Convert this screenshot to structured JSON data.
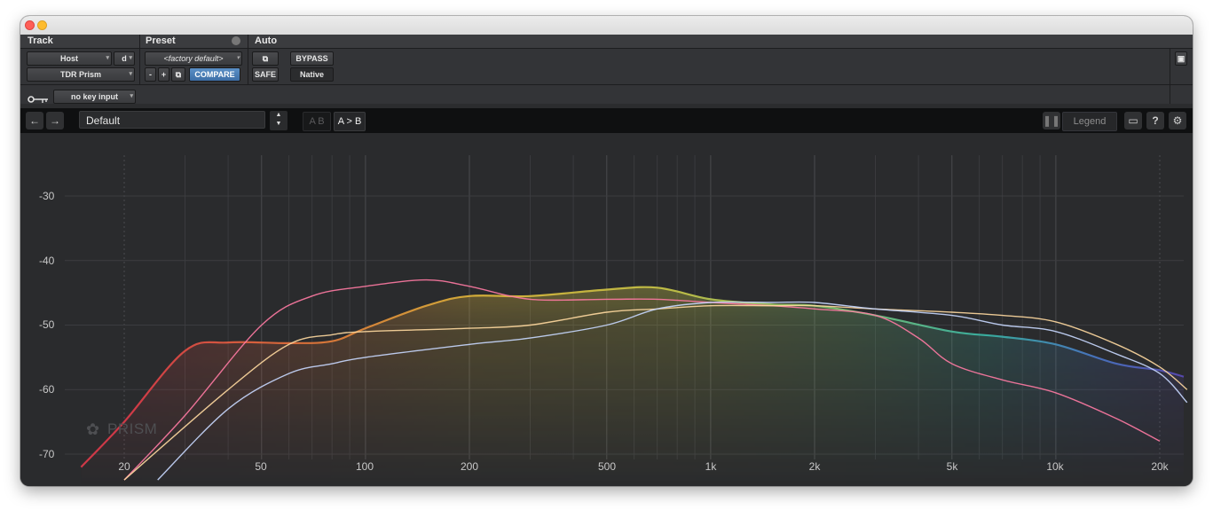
{
  "header": {
    "track": "Track",
    "preset": "Preset",
    "auto": "Auto"
  },
  "track": {
    "host": "Host",
    "channel": "d",
    "plugin": "TDR Prism"
  },
  "preset": {
    "name": "<factory default>",
    "minus": "-",
    "plus": "+",
    "compare": "COMPARE"
  },
  "auto": {
    "bypass": "BYPASS",
    "safe": "SAFE",
    "native": "Native"
  },
  "key_input": {
    "label": "no key input"
  },
  "toolbar": {
    "preset_name": "Default",
    "ab_inactive": "A B",
    "ab_copy": "A > B",
    "legend": "Legend",
    "help": "?"
  },
  "plot": {
    "watermark": "PRISM",
    "y_ticks": [
      "-30",
      "-40",
      "-50",
      "-60",
      "-70"
    ],
    "x_ticks": [
      "20",
      "50",
      "100",
      "200",
      "500",
      "1k",
      "2k",
      "5k",
      "10k",
      "20k"
    ]
  },
  "icons": {
    "back": "arrow-left-icon",
    "forward": "arrow-right-icon",
    "pause": "pause-icon",
    "display": "monitor-icon",
    "settings": "gear-icon",
    "key": "key-icon",
    "link": "link-icon"
  },
  "chart_data": {
    "type": "line",
    "x_scale": "log",
    "xlim": [
      15,
      24000
    ],
    "ylim": [
      -72,
      -24
    ],
    "series": [
      {
        "color": "#ff7aa3",
        "x": [
          20,
          30,
          50,
          70,
          100,
          150,
          200,
          300,
          500,
          700,
          1000,
          1500,
          2000,
          3000,
          4000,
          5000,
          7000,
          10000,
          15000,
          20000
        ],
        "y": [
          -74,
          -64,
          -50,
          -45.5,
          -44,
          -43,
          -44,
          -46,
          -46,
          -46,
          -46.5,
          -47,
          -47.5,
          -48.5,
          -52,
          -56,
          -58.5,
          -60.5,
          -64.5,
          -68
        ]
      },
      {
        "color": "#ffd9a0",
        "x": [
          20,
          40,
          60,
          80,
          100,
          200,
          300,
          500,
          700,
          1000,
          1500,
          2000,
          3000,
          5000,
          7000,
          10000,
          15000,
          20000,
          24000
        ],
        "y": [
          -74,
          -60,
          -53,
          -51.5,
          -51,
          -50.5,
          -50,
          -48,
          -47.5,
          -47,
          -47,
          -47,
          -47.5,
          -48,
          -48.5,
          -49.5,
          -53,
          -56.5,
          -60
        ]
      },
      {
        "color": "#c8d8ff",
        "x": [
          25,
          40,
          60,
          80,
          100,
          200,
          300,
          500,
          700,
          1000,
          1500,
          2000,
          3000,
          5000,
          7000,
          10000,
          15000,
          20000,
          24000
        ],
        "y": [
          -74,
          -63,
          -57.5,
          -56,
          -55,
          -53,
          -52,
          -50,
          -47.5,
          -46.5,
          -46.5,
          -46.5,
          -47.5,
          -48.5,
          -50,
          -51,
          -54.5,
          -57.5,
          -62
        ]
      }
    ],
    "spectrum": {
      "x": [
        15,
        20,
        30,
        40,
        60,
        80,
        100,
        150,
        200,
        300,
        500,
        700,
        1000,
        1500,
        2000,
        3000,
        5000,
        7000,
        10000,
        15000,
        20000,
        24000
      ],
      "y": [
        -72,
        -65,
        -54,
        -52.7,
        -52.8,
        -52.5,
        -50.5,
        -47,
        -45.5,
        -45.5,
        -44.5,
        -44.2,
        -46,
        -46.8,
        -47,
        -48.5,
        -51,
        -51.8,
        -53,
        -56,
        -57,
        -58
      ]
    }
  }
}
